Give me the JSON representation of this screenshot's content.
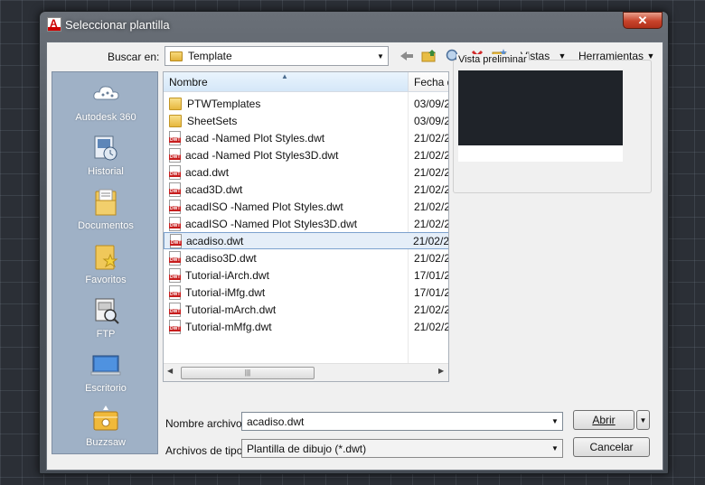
{
  "window": {
    "title": "Seleccionar plantilla",
    "close": "✕"
  },
  "toolbar": {
    "look_in_label": "Buscar en:",
    "look_in_value": "Template",
    "views_label": "Vistas",
    "tools_label": "Herramientas"
  },
  "places": [
    {
      "label": "Autodesk 360",
      "icon": "cloud-icon"
    },
    {
      "label": "Historial",
      "icon": "history-icon"
    },
    {
      "label": "Documentos",
      "icon": "documents-icon"
    },
    {
      "label": "Favoritos",
      "icon": "favorites-icon"
    },
    {
      "label": "FTP",
      "icon": "ftp-icon"
    },
    {
      "label": "Escritorio",
      "icon": "desktop-icon"
    },
    {
      "label": "Buzzsaw",
      "icon": "buzzsaw-icon"
    }
  ],
  "filelist": {
    "columns": [
      "Nombre",
      "Fecha d"
    ],
    "rows": [
      {
        "name": "PTWTemplates",
        "date": "03/09/2",
        "type": "folder"
      },
      {
        "name": "SheetSets",
        "date": "03/09/2",
        "type": "folder"
      },
      {
        "name": "acad -Named Plot Styles.dwt",
        "date": "21/02/2",
        "type": "dwt"
      },
      {
        "name": "acad -Named Plot Styles3D.dwt",
        "date": "21/02/2",
        "type": "dwt"
      },
      {
        "name": "acad.dwt",
        "date": "21/02/2",
        "type": "dwt"
      },
      {
        "name": "acad3D.dwt",
        "date": "21/02/2",
        "type": "dwt"
      },
      {
        "name": "acadISO -Named Plot Styles.dwt",
        "date": "21/02/2",
        "type": "dwt"
      },
      {
        "name": "acadISO -Named Plot Styles3D.dwt",
        "date": "21/02/2",
        "type": "dwt"
      },
      {
        "name": "acadiso.dwt",
        "date": "21/02/2",
        "type": "dwt",
        "selected": true
      },
      {
        "name": "acadiso3D.dwt",
        "date": "21/02/2",
        "type": "dwt"
      },
      {
        "name": "Tutorial-iArch.dwt",
        "date": "17/01/2",
        "type": "dwt"
      },
      {
        "name": "Tutorial-iMfg.dwt",
        "date": "17/01/2",
        "type": "dwt"
      },
      {
        "name": "Tutorial-mArch.dwt",
        "date": "21/02/2",
        "type": "dwt"
      },
      {
        "name": "Tutorial-mMfg.dwt",
        "date": "21/02/2",
        "type": "dwt"
      }
    ]
  },
  "preview": {
    "label": "Vista preliminar"
  },
  "bottom": {
    "filename_label": "Nombre archivo:",
    "filename_value": "acadiso.dwt",
    "filetype_label": "Archivos de tipo:",
    "filetype_value": "Plantilla de dibujo (*.dwt)",
    "open_label": "Abrir",
    "cancel_label": "Cancelar"
  },
  "colors": {
    "places_bg": "#9fb1c6",
    "close_red": "#c8432b",
    "selection": "#e5eef8"
  }
}
